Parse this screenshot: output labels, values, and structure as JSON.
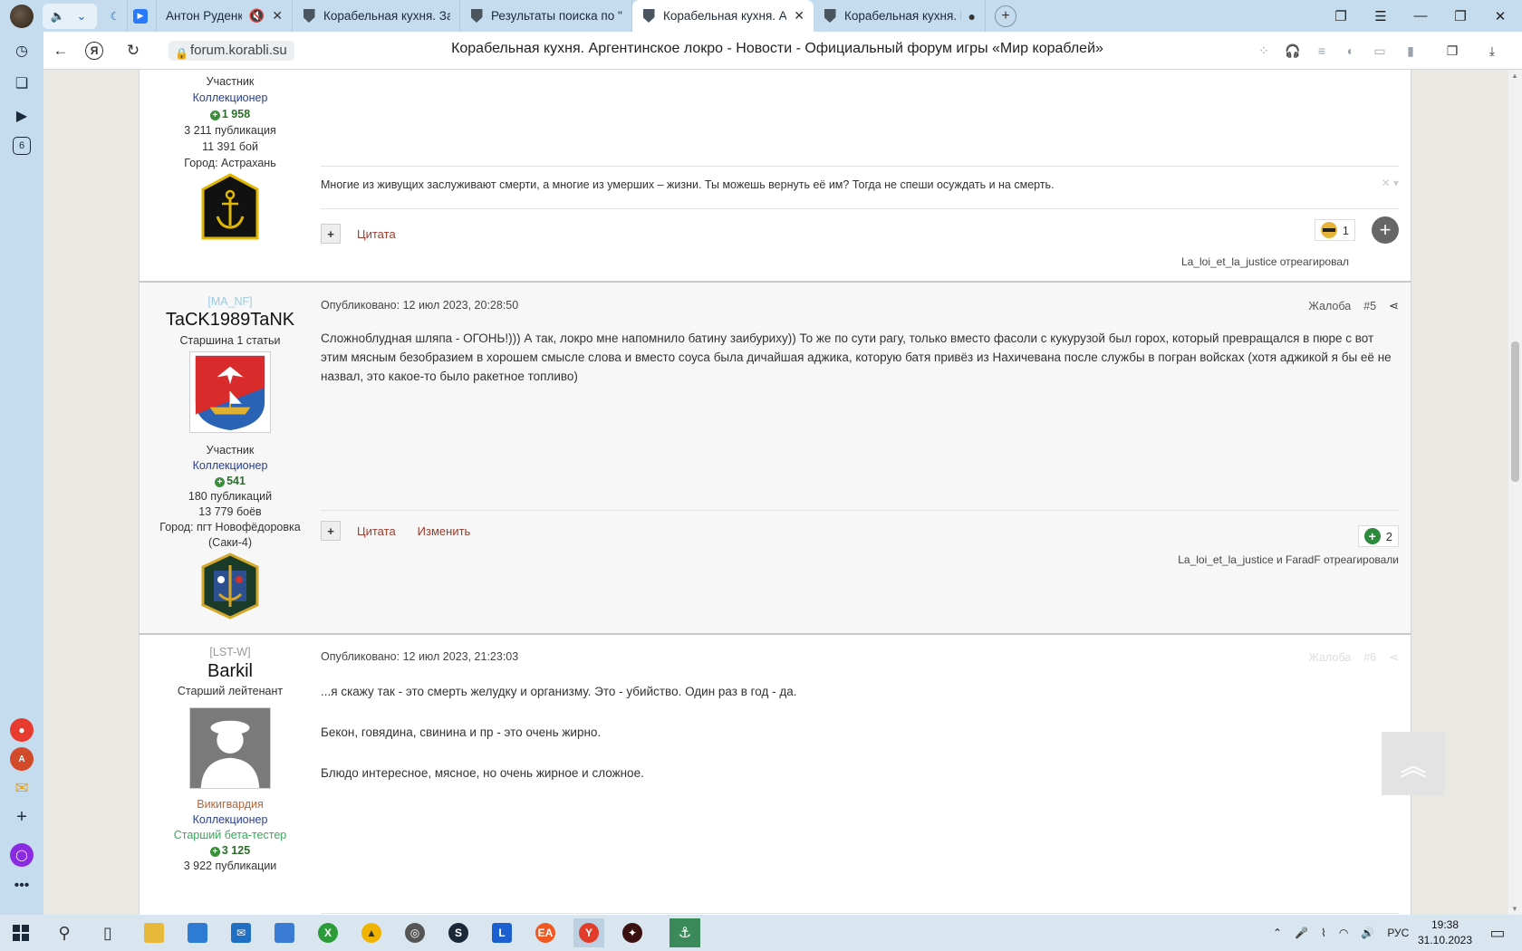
{
  "tabs": [
    {
      "title": "Антон Руденко",
      "muted": true
    },
    {
      "title": "Корабельная кухня. Заебу"
    },
    {
      "title": "Результаты поиска по \"Ко"
    },
    {
      "title": "Корабельная кухня. Ар",
      "active": true
    },
    {
      "title": "Корабельная кухня. Ш"
    }
  ],
  "address": {
    "url": "forum.korabli.su",
    "page_title": "Корабельная кухня. Аргентинское локро - Новости - Официальный форум игры «Мир кораблей»"
  },
  "left_panel": {
    "badge_number": "6"
  },
  "post4": {
    "author": {
      "group": "Участник",
      "title": "Коллекционер",
      "reputation": "1 958",
      "posts": "3 211 публикация",
      "battles": "11 391 бой",
      "city": "Город: Астрахань"
    },
    "signature": "Многие из живущих заслуживают смерти, а многие из умерших – жизни. Ты можешь вернуть её им? Тогда не спеши осуждать и на смерть.",
    "actions": {
      "quote": "Цитата"
    },
    "reactions": {
      "count": "1",
      "who": "La_loi_et_la_justice отреагировал"
    }
  },
  "post5": {
    "author": {
      "clan": "[MA_NF]",
      "name": "TaCK1989TaNK",
      "rank": "Старшина 1 статьи",
      "group": "Участник",
      "title": "Коллекционер",
      "reputation": "541",
      "posts": "180 публикаций",
      "battles": "13 779 боёв",
      "city": "Город: пгт Новофёдоровка",
      "city2": "(Саки-4)"
    },
    "meta": "Опубликовано: 12 июл 2023, 20:28:50",
    "report": "Жалоба",
    "number": "#5",
    "text": "Сложноблудная шляпа - ОГОНЬ!))) А так, локро мне напомнило батину заибуриху)) То же по сути рагу, только вместо фасоли с кукурузой был горох, который превращался в пюре с вот этим мясным безобразием в хорошем смысле слова и вместо соуса была дичайшая аджика, которую батя привёз из Нахичевана после службы в погран войсках (хотя аджикой я бы её не назвал, это какое-то было ракетное топливо)",
    "actions": {
      "quote": "Цитата",
      "edit": "Изменить"
    },
    "reactions": {
      "count": "2",
      "who": "La_loi_et_la_justice и FaradF отреагировали"
    }
  },
  "post6": {
    "author": {
      "clan": "[LST-W]",
      "name": "Barkil",
      "rank": "Старший лейтенант",
      "group": "Викигвардия",
      "title": "Коллекционер",
      "beta": "Старший бета-тестер",
      "reputation": "3 125",
      "posts": "3 922 публикации"
    },
    "meta": "Опубликовано: 12 июл 2023, 21:23:03",
    "report": "Жалоба",
    "number": "#6",
    "p1": "...я скажу так - это смерть желудку и организму. Это - убийство. Один раз в год - да.",
    "p2": "Бекон, говядина, свинина и пр - это очень жирно.",
    "p3": "Блюдо интересное, мясное, но очень жирное и сложное."
  },
  "taskbar": {
    "lang": "РУС",
    "time": "19:38",
    "date": "31.10.2023",
    "letter_l": "L"
  },
  "icons": {
    "back": "arrow-left-icon",
    "reload": "reload-icon",
    "lock": "lock-icon",
    "share": "share-icon",
    "plus": "plus-icon"
  },
  "colors": {
    "link": "#9b3b2b",
    "role_blue": "#2b3f8f",
    "reputation": "#2c6e2c",
    "browser_chrome": "#c5dcee"
  }
}
